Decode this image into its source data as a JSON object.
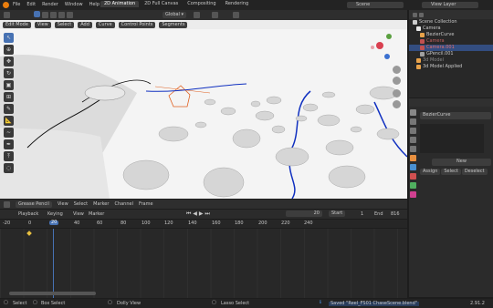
{
  "menu": {
    "items": [
      "File",
      "Edit",
      "Render",
      "Window",
      "Help"
    ]
  },
  "workspaces": {
    "tabs": [
      "2D Animation",
      "2D Full Canvas",
      "Compositing",
      "Rendering"
    ]
  },
  "scene": {
    "label": "Scene",
    "view_layer": "View Layer"
  },
  "viewport_header": {
    "mode": "Edit Mode",
    "menus": [
      "View",
      "Select",
      "Add",
      "Curve",
      "Control Points",
      "Segments"
    ],
    "transform": "Global"
  },
  "outliner": {
    "title": "Scene Collection",
    "items": [
      {
        "label": "Camera",
        "color": "#e8e8e8"
      },
      {
        "label": "BezierCurve",
        "color": "#e8a24a"
      },
      {
        "label": "Camera",
        "color": "#c05050"
      },
      {
        "label": "Camera.001",
        "color": "#c05050"
      },
      {
        "label": "GPencil.001",
        "color": "#a0a0a0"
      },
      {
        "label": "3d Model",
        "color": "#e8a24a"
      },
      {
        "label": "3d Model Applied",
        "color": "#e8a24a"
      }
    ]
  },
  "properties": {
    "object_name": "BezierCurve",
    "new_label": "New",
    "buttons": [
      "Assign",
      "Select",
      "Deselect"
    ]
  },
  "timeline_header": {
    "editor": "Grease Pencil",
    "menus": [
      "View",
      "Select",
      "Marker",
      "Channel",
      "Frame"
    ],
    "frame": "20",
    "start_label": "Start",
    "start": "1",
    "end_label": "End",
    "end": "816"
  },
  "playback": {
    "playback": "Playback",
    "keying": "Keying",
    "menus": [
      "View",
      "Marker"
    ]
  },
  "ruler": {
    "ticks": [
      "-20",
      "0",
      "20",
      "40",
      "60",
      "80",
      "100",
      "120",
      "140",
      "160",
      "180",
      "200",
      "220",
      "240"
    ],
    "current": "20"
  },
  "status": {
    "select": "Select",
    "box_select": "Box Select",
    "dolly": "Dolly View",
    "lasso": "Lasso Select",
    "saved": "Saved \"Reel_FS01 ChaseScene.blend\"",
    "version": "2.91.2"
  },
  "colors": {
    "accent": "#4772b3",
    "curve": "#1030c0",
    "viewport": "#f4f4f4"
  }
}
